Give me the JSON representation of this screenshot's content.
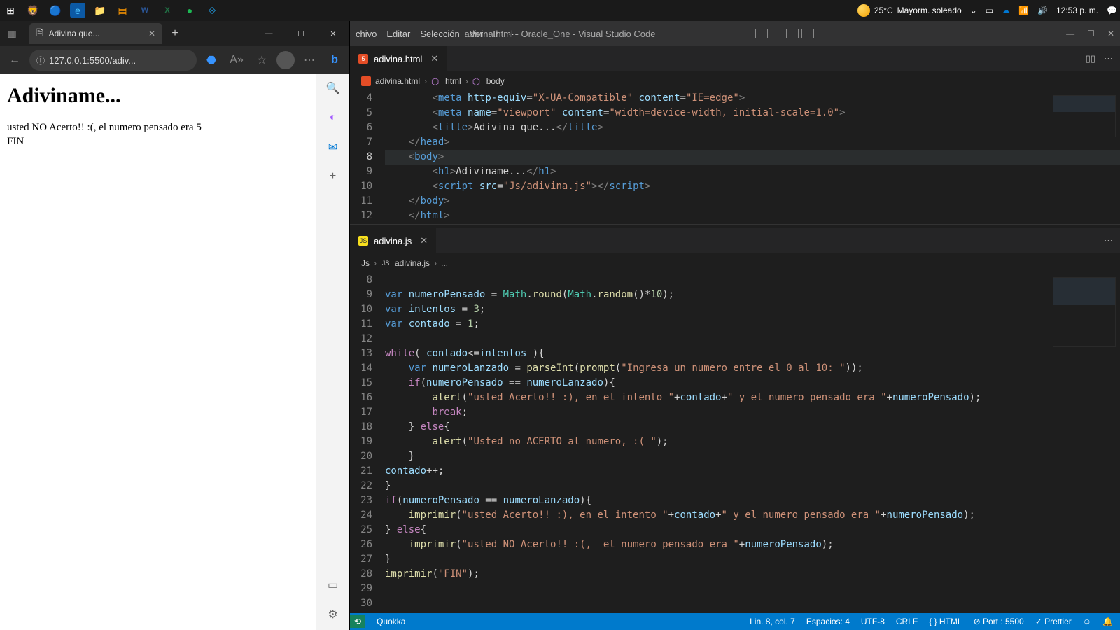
{
  "taskbar": {
    "weather_temp": "25°C",
    "weather_desc": "Mayorm. soleado",
    "time": "12:53 p. m."
  },
  "browser": {
    "tab_title": "Adivina que...",
    "url": "127.0.0.1:5500/adiv...",
    "page_heading": "Adiviname...",
    "page_line1": "usted NO Acerto!! :(, el numero pensado era 5",
    "page_line2": "FIN"
  },
  "vscode": {
    "menu": [
      "chivo",
      "Editar",
      "Selección",
      "Ver",
      "Ir",
      "···"
    ],
    "title": "adivina.html - Oracle_One - Visual Studio Code",
    "tab1": "adivina.html",
    "tab2": "adivina.js",
    "breadcrumb1": [
      "adivina.html",
      "html",
      "body"
    ],
    "breadcrumb2": [
      "Js",
      "adivina.js",
      "..."
    ],
    "status": {
      "quokka": "Quokka",
      "line": "Lin. 8, col. 7",
      "spaces": "Espacios: 4",
      "enc": "UTF-8",
      "eol": "CRLF",
      "lang": "HTML",
      "port": "Port : 5500",
      "prettier": "Prettier"
    },
    "html_lines": [
      4,
      5,
      6,
      7,
      8,
      9,
      10,
      11,
      12
    ],
    "js_lines": [
      8,
      9,
      10,
      11,
      12,
      13,
      14,
      15,
      16,
      17,
      18,
      19,
      20,
      21,
      22,
      23,
      24,
      25,
      26,
      27,
      28,
      29,
      30
    ]
  }
}
